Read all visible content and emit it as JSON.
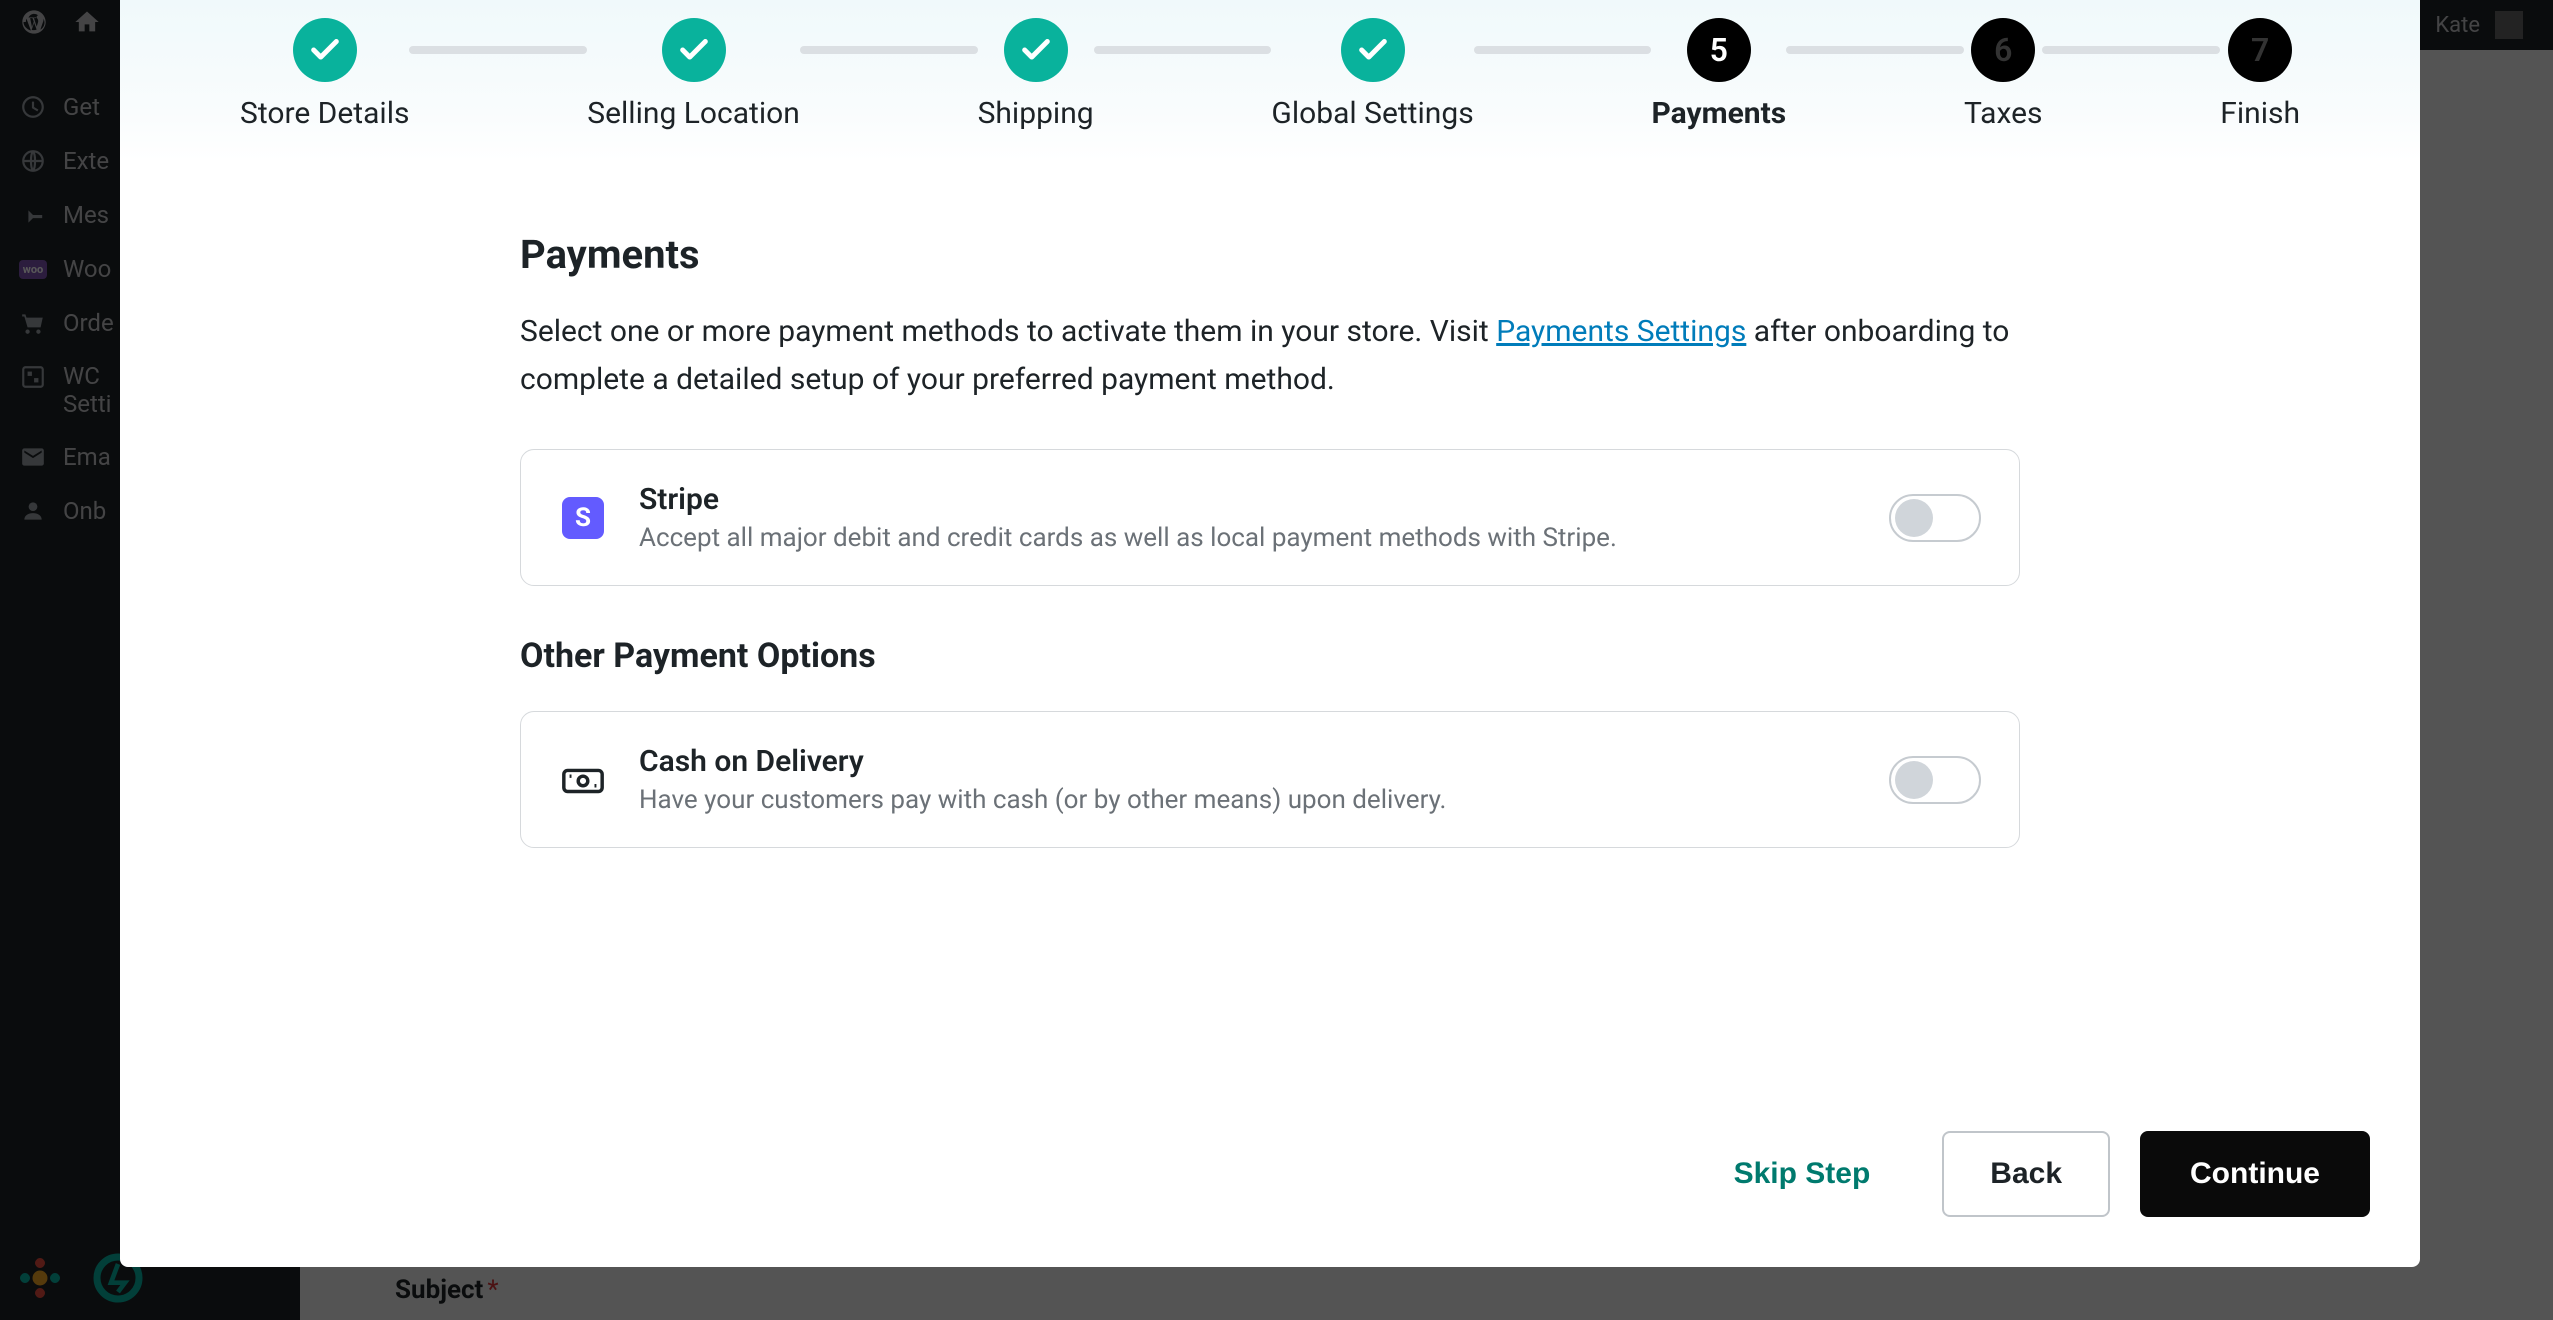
{
  "admin": {
    "user": "Kate",
    "sidebar": {
      "items": [
        {
          "label": "Get"
        },
        {
          "label": "Exte"
        },
        {
          "label": "Mes"
        },
        {
          "label": "Woo"
        },
        {
          "label": "Orde"
        },
        {
          "label": "WC"
        },
        {
          "label": "Setti"
        },
        {
          "label": "Ema"
        },
        {
          "label": "Onb"
        }
      ]
    },
    "subject_label": "Subject"
  },
  "wizard": {
    "steps": [
      {
        "label": "Store Details",
        "state": "completed"
      },
      {
        "label": "Selling Location",
        "state": "completed"
      },
      {
        "label": "Shipping",
        "state": "completed"
      },
      {
        "label": "Global Settings",
        "state": "completed"
      },
      {
        "label": "Payments",
        "state": "active",
        "number": "5"
      },
      {
        "label": "Taxes",
        "state": "pending",
        "number": "6"
      },
      {
        "label": "Finish",
        "state": "pending",
        "number": "7"
      }
    ],
    "title": "Payments",
    "description_before": "Select one or more payment methods to activate them in your store. Visit ",
    "description_link": "Payments Settings",
    "description_after": " after onboarding to complete a detailed setup of your preferred payment method.",
    "methods": [
      {
        "name": "Stripe",
        "description": "Accept all major debit and credit cards as well as local payment methods with Stripe.",
        "enabled": false,
        "icon": "stripe"
      }
    ],
    "other_title": "Other Payment Options",
    "other_methods": [
      {
        "name": "Cash on Delivery",
        "description": "Have your customers pay with cash (or by other means) upon delivery.",
        "enabled": false,
        "icon": "cash"
      }
    ],
    "footer": {
      "skip": "Skip Step",
      "back": "Back",
      "continue": "Continue"
    }
  }
}
